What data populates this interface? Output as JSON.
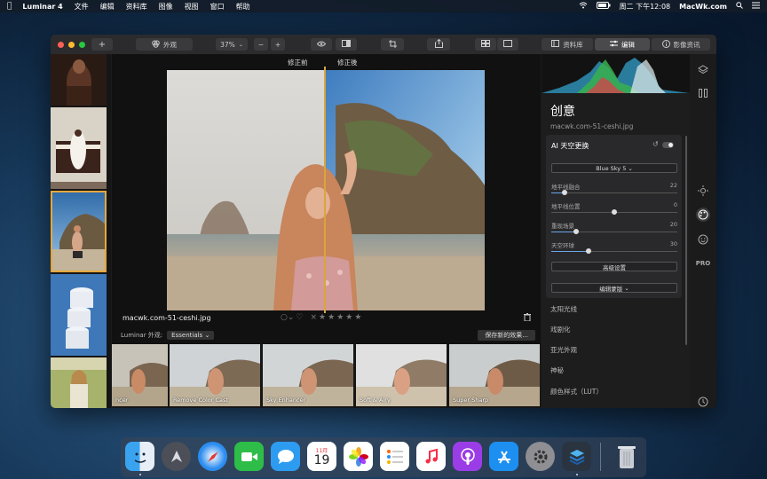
{
  "menubar": {
    "app_name": "Luminar 4",
    "menus": [
      "文件",
      "编辑",
      "资料库",
      "图像",
      "视图",
      "窗口",
      "帮助"
    ],
    "clock": "周二 下午12:08",
    "site": "MacWk.com"
  },
  "toolbar": {
    "add_label": "+",
    "looks_label": "外观",
    "zoom": "37%",
    "zoom_out": "−",
    "zoom_in": "+",
    "library_tab": "资料库",
    "edit_tab": "编辑",
    "info_tab": "影像资讯"
  },
  "canvas": {
    "before_label": "修正前",
    "after_label": "修正後",
    "filename": "macwk.com-51-ceshi.jpg",
    "rating_stars": 5
  },
  "looks_bar": {
    "prefix": "Luminar 外观:",
    "collection": "Essentials",
    "save_button": "保存新的效果..."
  },
  "looks": [
    {
      "label": "ncer"
    },
    {
      "label": "Remove Color Cast"
    },
    {
      "label": "Sky Enhancer"
    },
    {
      "label": "Soft & Airy"
    },
    {
      "label": "Super Sharp"
    }
  ],
  "panel": {
    "title": "创意",
    "subtitle": "macwk.com-51-ceshi.jpg",
    "ai_title": "AI 天空更换",
    "sky_select": "Blue Sky 5",
    "sliders": [
      {
        "label": "地平线融合",
        "value": 22
      },
      {
        "label": "地平线位置",
        "value": 0
      },
      {
        "label": "重现场景",
        "value": 20
      },
      {
        "label": "天空环球",
        "value": 30
      }
    ],
    "advanced_button": "高级设置",
    "mask_button": "编辑蒙版",
    "sections": [
      "太阳光线",
      "戏剧化",
      "亚光外观",
      "神秘",
      "颜色样式（LUT）"
    ]
  },
  "dock": {
    "calendar_month": "11月",
    "calendar_day": "19"
  },
  "colors": {
    "accent": "#e5a73b",
    "panel_bg": "#1d1d1e",
    "card_bg": "#29292b"
  }
}
